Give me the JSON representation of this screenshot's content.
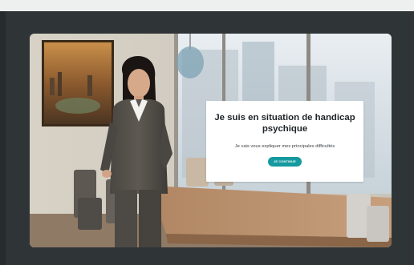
{
  "slide": {
    "title": "Je suis en situation de handicap psychique",
    "subtitle": "Je vais vous expliquer mes principales difficultés",
    "continue_label": "JE CONTINUE"
  },
  "colors": {
    "frame": "#2f3537",
    "accent": "#159aa0"
  }
}
